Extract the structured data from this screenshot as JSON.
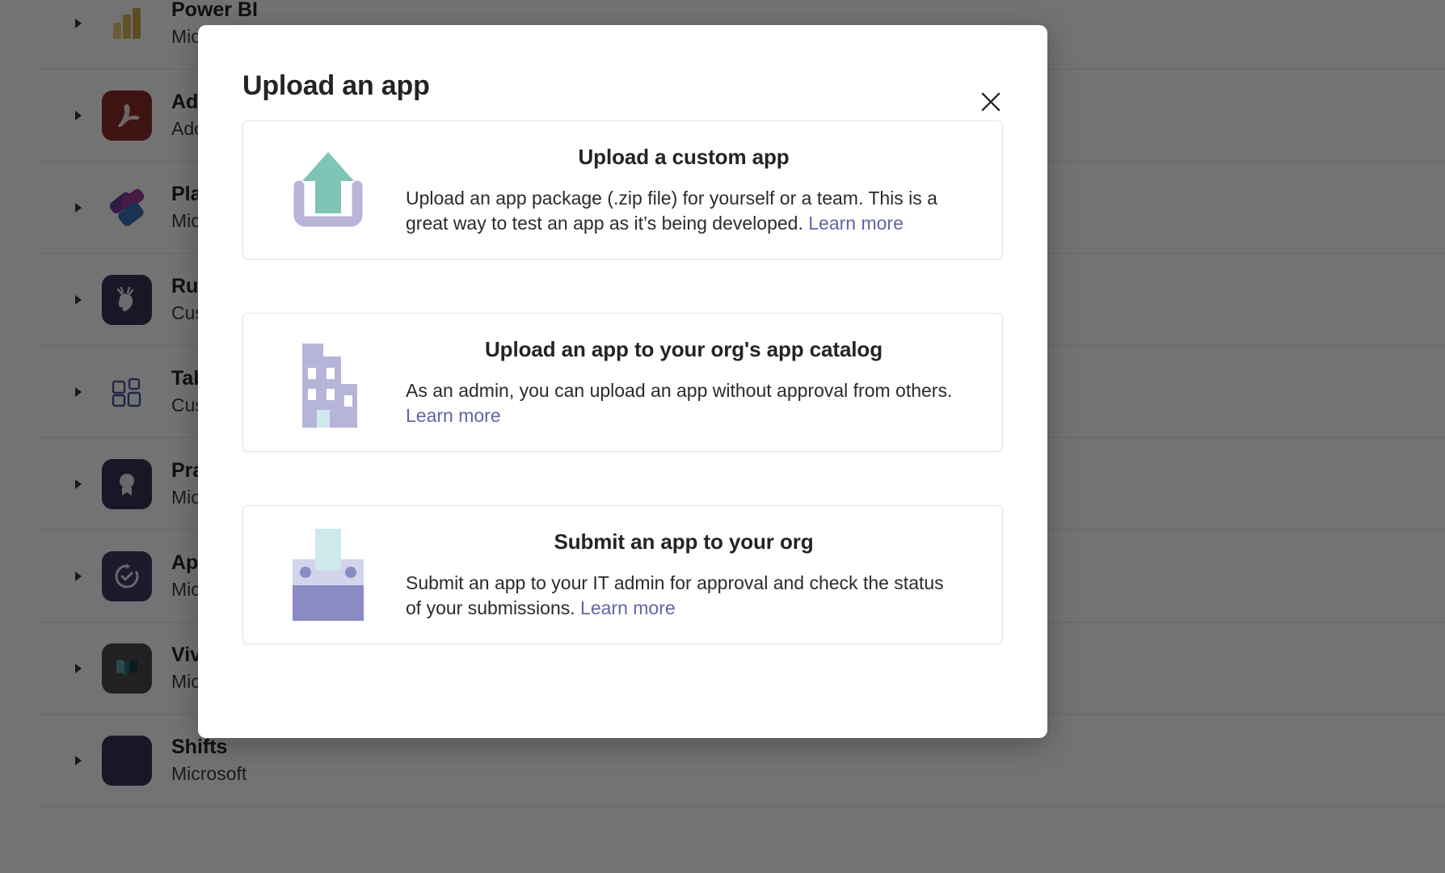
{
  "background": {
    "app_rows": [
      {
        "name": "Power BI",
        "publisher": "Microsoft",
        "icon": "power-bi-icon"
      },
      {
        "name": "Adobe Acrobat",
        "publisher": "Adobe",
        "icon": "adobe-acrobat-icon"
      },
      {
        "name": "Planner",
        "publisher": "Microsoft",
        "icon": "planner-icon"
      },
      {
        "name": "Rudolph",
        "publisher": "Custom app",
        "icon": "rudolph-icon"
      },
      {
        "name": "Tabs",
        "publisher": "Custom app",
        "icon": "tabs-icon"
      },
      {
        "name": "Praise",
        "publisher": "Microsoft",
        "icon": "praise-icon"
      },
      {
        "name": "Approvals",
        "publisher": "Microsoft",
        "icon": "approvals-icon"
      },
      {
        "name": "Viva Learning",
        "publisher": "Microsoft",
        "icon": "viva-icon"
      },
      {
        "name": "Shifts",
        "publisher": "Microsoft",
        "icon": "shifts-icon"
      }
    ],
    "expand_icon": "chevron-right-icon"
  },
  "modal": {
    "title": "Upload an app",
    "close_icon": "close-icon",
    "cards": [
      {
        "id": "card-custom",
        "icon": "upload-arrow-icon",
        "title": "Upload a custom app",
        "description": "Upload an app package (.zip file) for yourself or a team. This is a great way to test an app as it’s being developed. ",
        "link_label": "Learn more"
      },
      {
        "id": "card-catalog",
        "icon": "org-building-icon",
        "title": "Upload an app to your org's app catalog",
        "description": "As an admin, you can upload an app without approval from others. ",
        "link_label": "Learn more"
      },
      {
        "id": "card-submit",
        "icon": "submit-tray-icon",
        "title": "Submit an app to your org",
        "description": "Submit an app to your IT admin for approval and check the status of your submissions. ",
        "link_label": "Learn more"
      }
    ]
  },
  "colors": {
    "accent_link": "#6264a7",
    "upload_arrow": "#7fc5b5",
    "upload_tray": "#b8b5d9",
    "building": "#b7b4d9",
    "building_accent": "#cfe8ec",
    "submit_paper": "#cee8ec",
    "submit_tray_light": "#d3d3ea",
    "submit_tray_dark": "#8b8bc4",
    "overlay": "rgba(0,0,0,0.55)",
    "modal_bg": "#ffffff",
    "text_primary": "#242424"
  }
}
